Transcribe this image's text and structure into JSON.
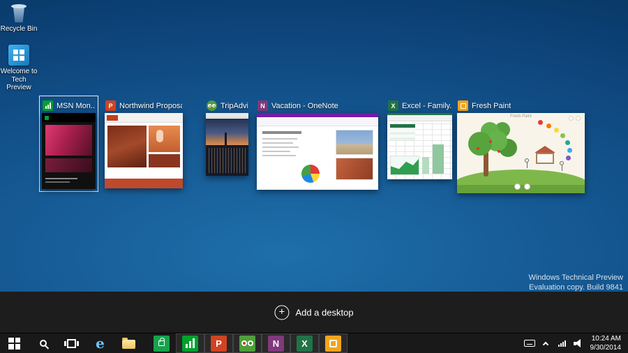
{
  "desktop": {
    "icons": [
      {
        "label": "Recycle Bin"
      },
      {
        "label": "Welcome to Tech Preview"
      }
    ],
    "watermark": {
      "line1": "Windows Technical Preview",
      "line2": "Evaluation copy. Build 9841"
    }
  },
  "task_view": {
    "add_desktop_label": "Add a desktop",
    "windows": [
      {
        "title": "MSN Mon...",
        "app": "MSN Money",
        "selected": true
      },
      {
        "title": "Northwind Proposa...",
        "app": "PowerPoint"
      },
      {
        "title": "TripAdvisor...",
        "app": "TripAdvisor"
      },
      {
        "title": "Vacation - OneNote",
        "app": "OneNote"
      },
      {
        "title": "Excel - Family...",
        "app": "Excel"
      },
      {
        "title": "Fresh Paint",
        "app": "Fresh Paint",
        "preview_title": "Fresh Paint"
      }
    ]
  },
  "taskbar": {
    "icons": [
      "start",
      "search",
      "task-view",
      "internet-explorer",
      "file-explorer",
      "store",
      "msn-money",
      "powerpoint",
      "tripadvisor",
      "onenote",
      "excel",
      "fresh-paint"
    ],
    "tray_icons": [
      "touch-keyboard",
      "show-hidden-icons",
      "network",
      "volume"
    ],
    "tray": {
      "time": "10:24 AM",
      "date": "9/30/2014"
    }
  },
  "glyphs": {
    "powerpoint": "P",
    "onenote": "N",
    "excel": "X",
    "internet_explorer": "e",
    "plus": "+"
  },
  "colors": {
    "msn_green": "#00a12d",
    "powerpoint_orange": "#d04423",
    "tripadvisor_green": "#4f9e3c",
    "onenote_purple": "#80397b",
    "excel_green": "#217346",
    "fresh_paint_yellow": "#f2a51e"
  }
}
